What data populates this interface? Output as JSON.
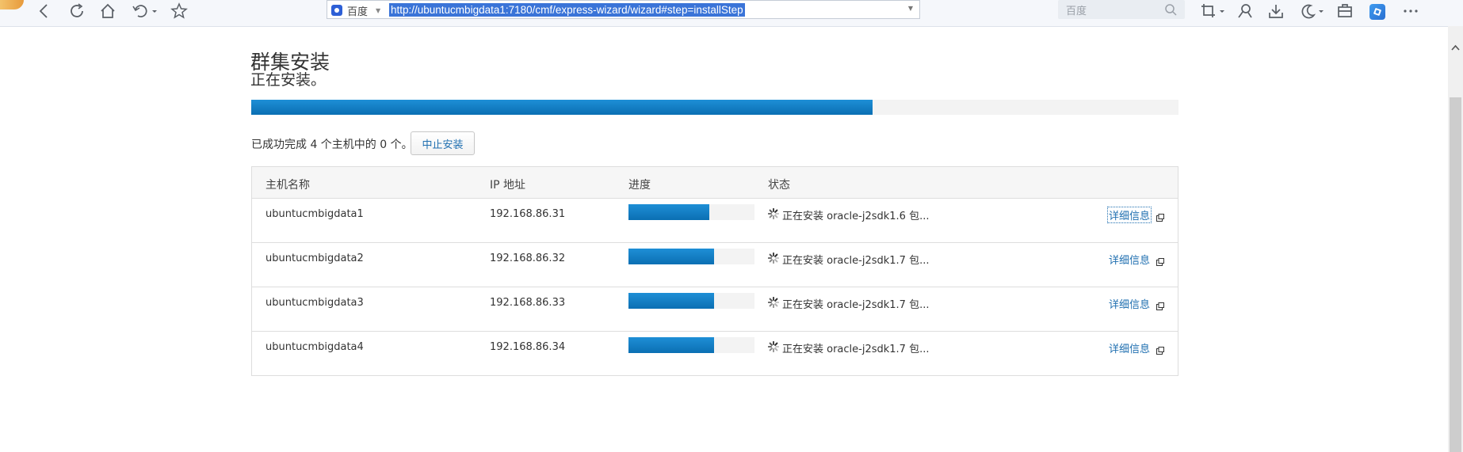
{
  "browser": {
    "search_engine": "百度",
    "url": "http://ubuntucmbigdata1:7180/cmf/express-wizard/wizard#step=installStep",
    "search_placeholder": "百度",
    "icons": [
      "back-icon",
      "refresh-icon",
      "home-icon",
      "undo-icon",
      "bookmark-star-icon",
      "screenshot-icon",
      "magnifier-person-icon",
      "download-icon",
      "night-mode-icon",
      "toolbox-icon",
      "extension-icon",
      "more-icon"
    ]
  },
  "page": {
    "title": "群集安装",
    "status_text": "正在安装。",
    "overall_progress": 0.67,
    "summary": "已成功完成 4 个主机中的 0 个。",
    "abort_label": "中止安装"
  },
  "table": {
    "headers": {
      "hostname": "主机名称",
      "ip": "IP 地址",
      "progress": "进度",
      "status": "状态"
    },
    "rows": [
      {
        "hostname": "ubuntucmbigdata1",
        "ip": "192.168.86.31",
        "progress": 0.64,
        "status": "正在安装 oracle-j2sdk1.6 包...",
        "details": "详细信息"
      },
      {
        "hostname": "ubuntucmbigdata2",
        "ip": "192.168.86.32",
        "progress": 0.68,
        "status": "正在安装 oracle-j2sdk1.7 包...",
        "details": "详细信息"
      },
      {
        "hostname": "ubuntucmbigdata3",
        "ip": "192.168.86.33",
        "progress": 0.68,
        "status": "正在安装 oracle-j2sdk1.7 包...",
        "details": "详细信息"
      },
      {
        "hostname": "ubuntucmbigdata4",
        "ip": "192.168.86.34",
        "progress": 0.68,
        "status": "正在安装 oracle-j2sdk1.7 包...",
        "details": "详细信息"
      }
    ]
  },
  "colors": {
    "progress_fill": "#1a86cc",
    "link": "#1f6fb0",
    "url_highlight": "#3a74d8"
  }
}
